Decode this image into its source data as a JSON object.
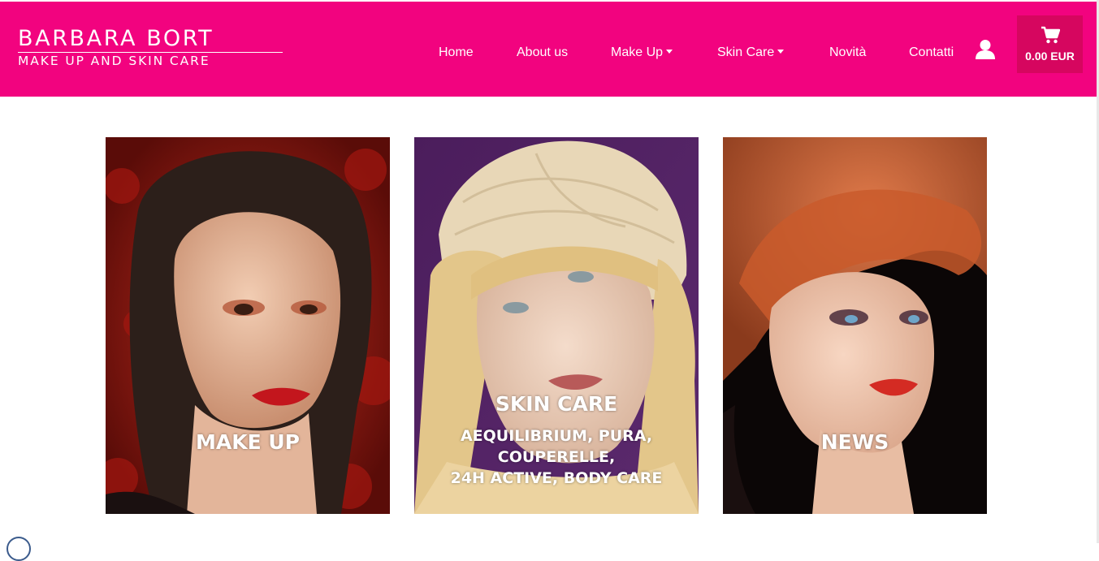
{
  "brand": {
    "name": "BARBARA BORT",
    "tagline": "MAKE UP AND SKIN CARE"
  },
  "nav": {
    "items": [
      {
        "label": "Home"
      },
      {
        "label": "About us"
      },
      {
        "label": "Make Up"
      },
      {
        "label": "Skin Care"
      },
      {
        "label": "Novità"
      },
      {
        "label": "Contatti"
      }
    ]
  },
  "cart": {
    "total": "0.00 EUR",
    "icon": "shopping-cart-icon"
  },
  "account": {
    "icon": "user-icon"
  },
  "tiles": [
    {
      "title": "MAKE UP"
    },
    {
      "title": "SKIN CARE",
      "subtitle_lines": [
        "AEQUILIBRIUM, PURA,",
        "COUPERELLE,",
        "24H ACTIVE, BODY CARE"
      ]
    },
    {
      "title": "NEWS"
    }
  ],
  "colors": {
    "header_bg": "#f2037f",
    "cart_bg": "#d6065f",
    "text_on_header": "#ffffff"
  }
}
